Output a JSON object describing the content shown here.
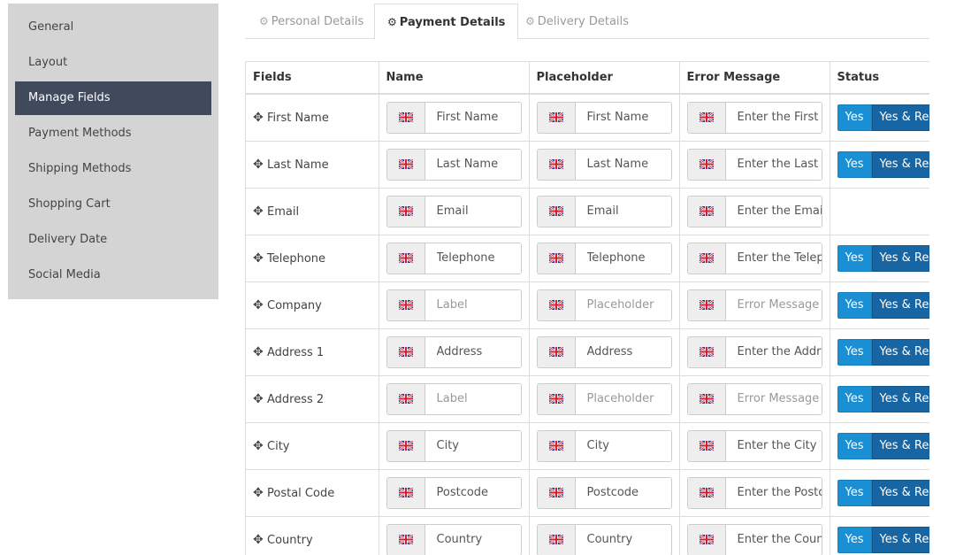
{
  "sidebar": {
    "items": [
      {
        "label": "General"
      },
      {
        "label": "Layout"
      },
      {
        "label": "Manage Fields",
        "active": true
      },
      {
        "label": "Payment Methods"
      },
      {
        "label": "Shipping Methods"
      },
      {
        "label": "Shopping Cart"
      },
      {
        "label": "Delivery Date"
      },
      {
        "label": "Social Media"
      }
    ]
  },
  "tabs": [
    {
      "label": "Personal Details",
      "icon": "gear-icon"
    },
    {
      "label": "Payment Details",
      "icon": "gear-icon",
      "active": true
    },
    {
      "label": "Delivery Details",
      "icon": "gear-icon"
    }
  ],
  "table": {
    "headers": [
      "Fields",
      "Name",
      "Placeholder",
      "Error Message",
      "Status"
    ],
    "status_labels": {
      "yes": "Yes",
      "required": "Yes & Required"
    },
    "rows": [
      {
        "field": "First Name",
        "name": "First Name",
        "placeholder": "First Name",
        "error": "Enter the First Name",
        "name_is_placeholder": false,
        "placeholder_is_placeholder": false,
        "error_is_placeholder": false,
        "status": true
      },
      {
        "field": "Last Name",
        "name": "Last Name",
        "placeholder": "Last Name",
        "error": "Enter the Last Name",
        "name_is_placeholder": false,
        "placeholder_is_placeholder": false,
        "error_is_placeholder": false,
        "status": true
      },
      {
        "field": "Email",
        "name": "Email",
        "placeholder": "Email",
        "error": "Enter the Email",
        "name_is_placeholder": false,
        "placeholder_is_placeholder": false,
        "error_is_placeholder": false,
        "status": false
      },
      {
        "field": "Telephone",
        "name": "Telephone",
        "placeholder": "Telephone",
        "error": "Enter the Telephone",
        "name_is_placeholder": false,
        "placeholder_is_placeholder": false,
        "error_is_placeholder": false,
        "status": true
      },
      {
        "field": "Company",
        "name": "Label",
        "placeholder": "Placeholder",
        "error": "Error Message",
        "name_is_placeholder": true,
        "placeholder_is_placeholder": true,
        "error_is_placeholder": true,
        "status": true
      },
      {
        "field": "Address 1",
        "name": "Address",
        "placeholder": "Address",
        "error": "Enter the Address",
        "name_is_placeholder": false,
        "placeholder_is_placeholder": false,
        "error_is_placeholder": false,
        "status": true
      },
      {
        "field": "Address 2",
        "name": "Label",
        "placeholder": "Placeholder",
        "error": "Error Message",
        "name_is_placeholder": true,
        "placeholder_is_placeholder": true,
        "error_is_placeholder": true,
        "status": true
      },
      {
        "field": "City",
        "name": "City",
        "placeholder": "City",
        "error": "Enter the City",
        "name_is_placeholder": false,
        "placeholder_is_placeholder": false,
        "error_is_placeholder": false,
        "status": true
      },
      {
        "field": "Postal Code",
        "name": "Postcode",
        "placeholder": "Postcode",
        "error": "Enter the Postcode",
        "name_is_placeholder": false,
        "placeholder_is_placeholder": false,
        "error_is_placeholder": false,
        "status": true
      },
      {
        "field": "Country",
        "name": "Country",
        "placeholder": "Country",
        "error": "Enter the Country",
        "name_is_placeholder": false,
        "placeholder_is_placeholder": false,
        "error_is_placeholder": false,
        "status": true
      }
    ]
  },
  "colors": {
    "sidebar_bg": "#d4d4d4",
    "sidebar_active": "#414a5c",
    "btn_yes": "#1a8fd3",
    "btn_required": "#1766a3"
  }
}
